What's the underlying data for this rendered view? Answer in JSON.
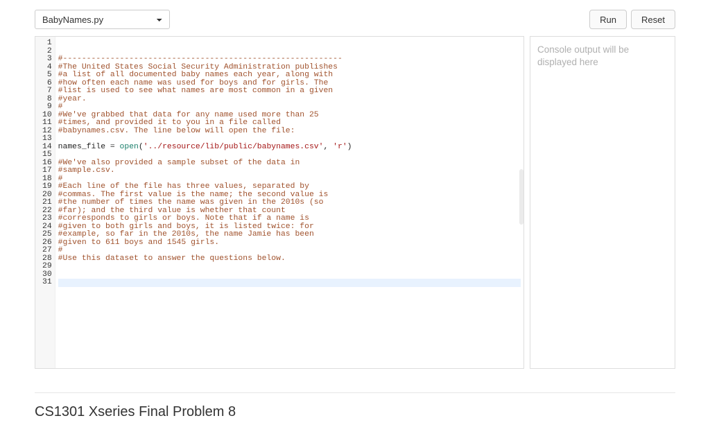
{
  "toolbar": {
    "file_select_value": "BabyNames.py",
    "run_label": "Run",
    "reset_label": "Reset"
  },
  "console": {
    "placeholder": "Console output will be displayed here"
  },
  "footer": {
    "problem_title": "CS1301 Xseries Final Problem 8"
  },
  "editor": {
    "active_line": 29,
    "lines": [
      {
        "n": 1,
        "tokens": [
          {
            "t": "#-----------------------------------------------------------",
            "c": "comment"
          }
        ]
      },
      {
        "n": 2,
        "tokens": [
          {
            "t": "#The United States Social Security Administration publishes",
            "c": "comment"
          }
        ]
      },
      {
        "n": 3,
        "tokens": [
          {
            "t": "#a list of all documented baby names each year, along with",
            "c": "comment"
          }
        ]
      },
      {
        "n": 4,
        "tokens": [
          {
            "t": "#how often each name was used for boys and for girls. The",
            "c": "comment"
          }
        ]
      },
      {
        "n": 5,
        "tokens": [
          {
            "t": "#list is used to see what names are most common in a given",
            "c": "comment"
          }
        ]
      },
      {
        "n": 6,
        "tokens": [
          {
            "t": "#year.",
            "c": "comment"
          }
        ]
      },
      {
        "n": 7,
        "tokens": [
          {
            "t": "#",
            "c": "comment"
          }
        ]
      },
      {
        "n": 8,
        "tokens": [
          {
            "t": "#We've grabbed that data for any name used more than 25",
            "c": "comment"
          }
        ]
      },
      {
        "n": 9,
        "tokens": [
          {
            "t": "#times, and provided it to you in a file called",
            "c": "comment"
          }
        ]
      },
      {
        "n": 10,
        "tokens": [
          {
            "t": "#babynames.csv. The line below will open the file:",
            "c": "comment"
          }
        ]
      },
      {
        "n": 11,
        "tokens": []
      },
      {
        "n": 12,
        "tokens": [
          {
            "t": "names_file ",
            "c": "name"
          },
          {
            "t": "= ",
            "c": "punct"
          },
          {
            "t": "open",
            "c": "builtin"
          },
          {
            "t": "(",
            "c": "punct"
          },
          {
            "t": "'../resource/lib/public/babynames.csv'",
            "c": "str"
          },
          {
            "t": ", ",
            "c": "punct"
          },
          {
            "t": "'r'",
            "c": "str"
          },
          {
            "t": ")",
            "c": "punct"
          }
        ]
      },
      {
        "n": 13,
        "tokens": []
      },
      {
        "n": 14,
        "tokens": [
          {
            "t": "#We've also provided a sample subset of the data in",
            "c": "comment"
          }
        ]
      },
      {
        "n": 15,
        "tokens": [
          {
            "t": "#sample.csv.",
            "c": "comment"
          }
        ]
      },
      {
        "n": 16,
        "tokens": [
          {
            "t": "#",
            "c": "comment"
          }
        ]
      },
      {
        "n": 17,
        "tokens": [
          {
            "t": "#Each line of the file has three values, separated by",
            "c": "comment"
          }
        ]
      },
      {
        "n": 18,
        "tokens": [
          {
            "t": "#commas. The first value is the name; the second value is",
            "c": "comment"
          }
        ]
      },
      {
        "n": 19,
        "tokens": [
          {
            "t": "#the number of times the name was given in the 2010s (so",
            "c": "comment"
          }
        ]
      },
      {
        "n": 20,
        "tokens": [
          {
            "t": "#far); and the third value is whether that count",
            "c": "comment"
          }
        ]
      },
      {
        "n": 21,
        "tokens": [
          {
            "t": "#corresponds to girls or boys. Note that if a name is",
            "c": "comment"
          }
        ]
      },
      {
        "n": 22,
        "tokens": [
          {
            "t": "#given to both girls and boys, it is listed twice: for",
            "c": "comment"
          }
        ]
      },
      {
        "n": 23,
        "tokens": [
          {
            "t": "#example, so far in the 2010s, the name Jamie has been",
            "c": "comment"
          }
        ]
      },
      {
        "n": 24,
        "tokens": [
          {
            "t": "#given to 611 boys and 1545 girls.",
            "c": "comment"
          }
        ]
      },
      {
        "n": 25,
        "tokens": [
          {
            "t": "#",
            "c": "comment"
          }
        ]
      },
      {
        "n": 26,
        "tokens": [
          {
            "t": "#Use this dataset to answer the questions below.",
            "c": "comment"
          }
        ]
      },
      {
        "n": 27,
        "tokens": []
      },
      {
        "n": 28,
        "tokens": []
      },
      {
        "n": 29,
        "tokens": []
      },
      {
        "n": 30,
        "tokens": []
      },
      {
        "n": 31,
        "tokens": []
      }
    ]
  }
}
